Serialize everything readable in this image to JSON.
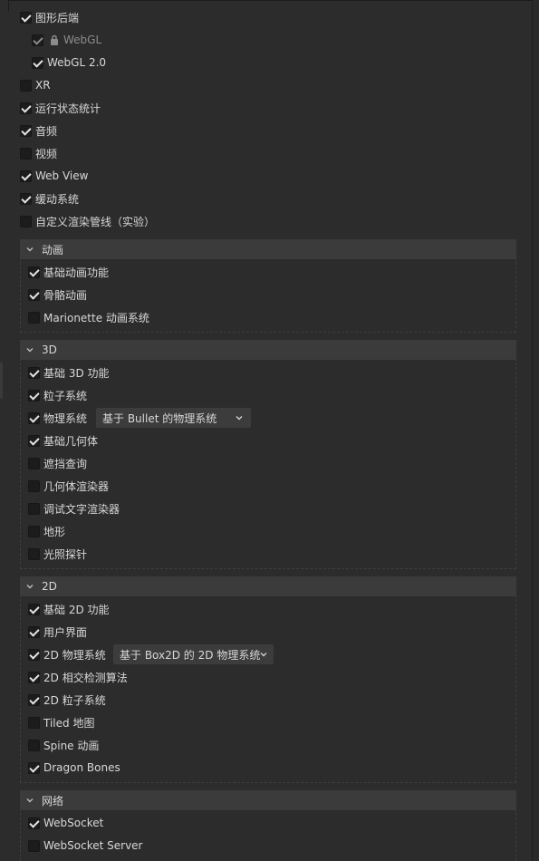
{
  "top": {
    "graphics_backend": {
      "label": "图形后端",
      "checked": true
    },
    "webgl": {
      "label": "WebGL",
      "checked": true,
      "locked": true
    },
    "webgl2": {
      "label": "WebGL 2.0",
      "checked": true
    },
    "items": [
      {
        "label": "XR",
        "checked": false
      },
      {
        "label": "运行状态统计",
        "checked": true
      },
      {
        "label": "音频",
        "checked": true
      },
      {
        "label": "视频",
        "checked": false
      },
      {
        "label": "Web View",
        "checked": true
      },
      {
        "label": "缓动系统",
        "checked": true
      },
      {
        "label": "自定义渲染管线（实验）",
        "checked": false
      }
    ]
  },
  "animation": {
    "title": "动画",
    "items": [
      {
        "label": "基础动画功能",
        "checked": true
      },
      {
        "label": "骨骼动画",
        "checked": true
      },
      {
        "label": "Marionette 动画系统",
        "checked": false
      }
    ]
  },
  "three_d": {
    "title": "3D",
    "items": [
      {
        "label": "基础 3D 功能",
        "checked": true
      },
      {
        "label": "粒子系统",
        "checked": true
      },
      {
        "label": "物理系统",
        "checked": true
      },
      {
        "label": "基础几何体",
        "checked": true
      },
      {
        "label": "遮挡查询",
        "checked": false
      },
      {
        "label": "几何体渲染器",
        "checked": false
      },
      {
        "label": "调试文字渲染器",
        "checked": false
      },
      {
        "label": "地形",
        "checked": false
      },
      {
        "label": "光照探针",
        "checked": false
      }
    ],
    "physics_select": "基于 Bullet 的物理系统"
  },
  "two_d": {
    "title": "2D",
    "items": [
      {
        "label": "基础 2D 功能",
        "checked": true
      },
      {
        "label": "用户界面",
        "checked": true
      },
      {
        "label": "2D 物理系统",
        "checked": true
      },
      {
        "label": "2D 相交检测算法",
        "checked": true
      },
      {
        "label": "2D 粒子系统",
        "checked": true
      },
      {
        "label": "Tiled 地图",
        "checked": false
      },
      {
        "label": "Spine 动画",
        "checked": false
      },
      {
        "label": "Dragon Bones",
        "checked": true
      }
    ],
    "physics_select": "基于 Box2D 的 2D 物理系统"
  },
  "network": {
    "title": "网络",
    "items": [
      {
        "label": "WebSocket",
        "checked": true
      },
      {
        "label": "WebSocket Server",
        "checked": false
      }
    ]
  },
  "icons": {
    "lock": "lock-icon",
    "chevron": "chevron-down-icon"
  }
}
